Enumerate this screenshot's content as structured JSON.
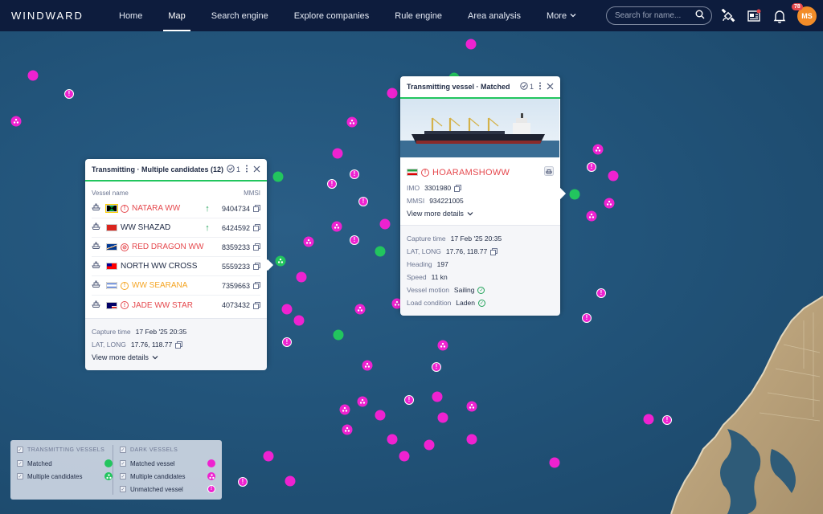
{
  "brand": "WINDWARD",
  "nav": [
    {
      "label": "Home"
    },
    {
      "label": "Map",
      "active": true
    },
    {
      "label": "Search engine"
    },
    {
      "label": "Explore companies"
    },
    {
      "label": "Rule engine"
    },
    {
      "label": "Area analysis"
    },
    {
      "label": "More",
      "dropdown": true
    }
  ],
  "search": {
    "placeholder": "Search for name..."
  },
  "top_icons": [
    "satellite-icon",
    "news-icon",
    "bell-icon"
  ],
  "notifications_count": "78",
  "user_initials": "MS",
  "colors": {
    "nav_bg": "#0d1c3d",
    "matched": "#22c55e",
    "dark_vessel": "#ee22d0",
    "alert_red": "#e5484d",
    "alert_orange": "#f5a524"
  },
  "popup_candidates": {
    "title": "Transmitting · Multiple candidates (12)",
    "check_count": "1",
    "col_vessel": "Vessel name",
    "col_mmsi": "MMSI",
    "rows": [
      {
        "name": "NATARA WW",
        "mmsi": "9404734",
        "color": "red",
        "flag": "jamaica",
        "warn": "alert",
        "arrow": true
      },
      {
        "name": "WW SHAZAD",
        "mmsi": "6424592",
        "color": "dark",
        "flag": "vietnam",
        "warn": "",
        "arrow": true
      },
      {
        "name": "RED DRAGON WW",
        "mmsi": "8359233",
        "color": "red",
        "flag": "marshall",
        "warn": "blocked",
        "arrow": false
      },
      {
        "name": "NORTH WW CROSS",
        "mmsi": "5559233",
        "color": "dark",
        "flag": "taiwan",
        "warn": "",
        "arrow": false
      },
      {
        "name": "WW SEARANA",
        "mmsi": "7359663",
        "color": "orange",
        "flag": "israel",
        "warn": "alert",
        "arrow": false
      },
      {
        "name": "JADE WW STAR",
        "mmsi": "4073432",
        "color": "red",
        "flag": "malaysia",
        "warn": "alert",
        "arrow": false
      }
    ],
    "capture_label": "Capture time",
    "capture_value": "17 Feb '25 20:35",
    "latlong_label": "LAT, LONG",
    "latlong_value": "17.76, 118.77",
    "more_label": "View more details"
  },
  "popup_matched": {
    "title": "Transmitting vessel · Matched",
    "check_count": "1",
    "vessel_name": "HOARAMSHOWW",
    "imo_label": "IMO",
    "imo_value": "3301980",
    "mmsi_label": "MMSI",
    "mmsi_value": "934221005",
    "more_label": "View more details",
    "capture_label": "Capture time",
    "capture_value": "17 Feb '25 20:35",
    "latlong_label": "LAT, LONG",
    "latlong_value": "17.76, 118.77",
    "heading_label": "Heading",
    "heading_value": "197",
    "speed_label": "Speed",
    "speed_value": "11 kn",
    "motion_label": "Vessel motion",
    "motion_value": "Sailing",
    "load_label": "Load condition",
    "load_value": "Laden"
  },
  "legend": {
    "transmitting_title": "TRANSMITTING VESSELS",
    "matched": "Matched",
    "multiple": "Multiple candidates",
    "dark_title": "DARK VESSELS",
    "dark_matched": "Matched vessel",
    "dark_multiple": "Multiple candidates",
    "dark_unmatched": "Unmatched vessel"
  }
}
